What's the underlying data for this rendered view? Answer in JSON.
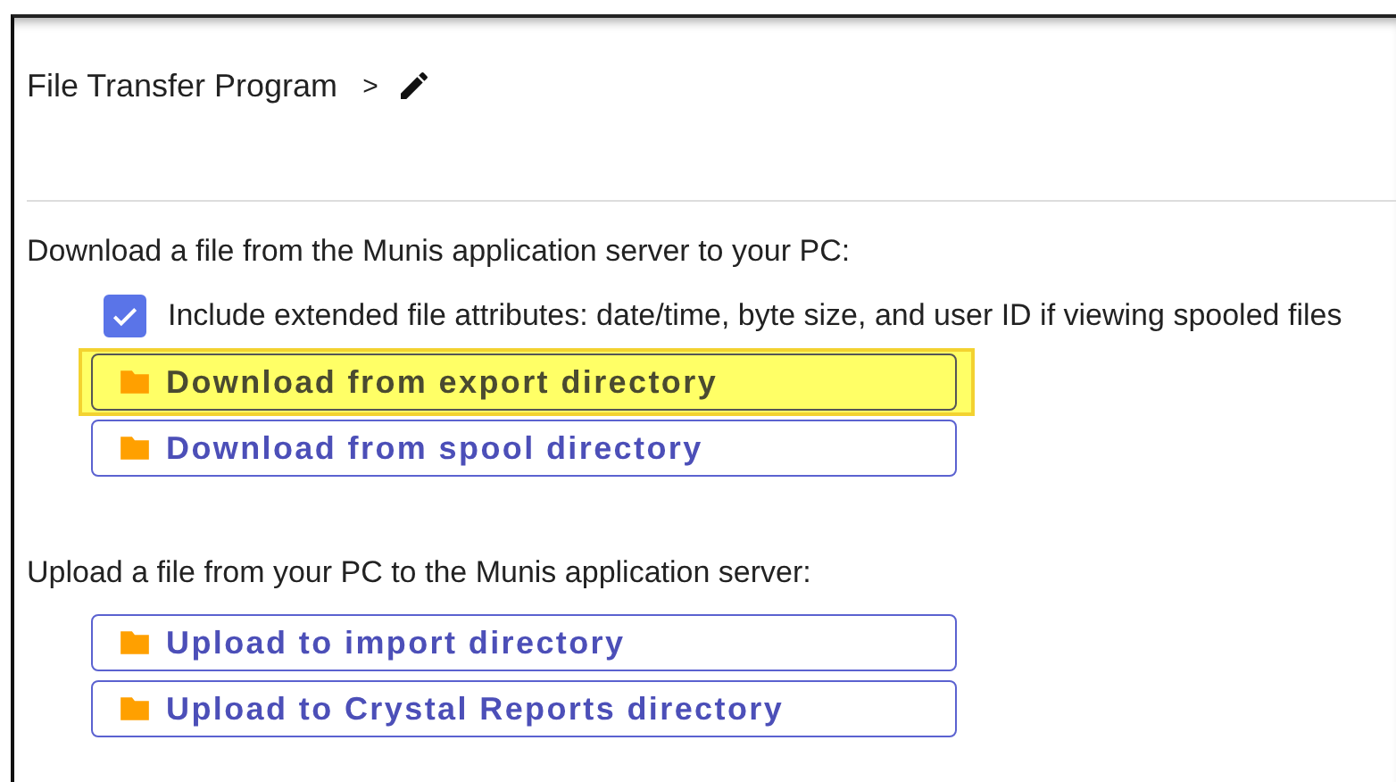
{
  "header": {
    "title": "File Transfer Program",
    "separator": ">"
  },
  "sections": [
    {
      "label": "Download a file from the Munis application server to your PC:",
      "checkbox": {
        "label": "Include extended file attributes: date/time, byte size, and user ID if viewing spooled files",
        "checked": true
      },
      "buttons": [
        {
          "label": "Download from export directory",
          "selected": true
        },
        {
          "label": "Download from spool directory",
          "selected": false
        }
      ]
    },
    {
      "label": "Upload a file from your PC to the Munis application server:",
      "buttons": [
        {
          "label": "Upload to import directory",
          "selected": false
        },
        {
          "label": "Upload to Crystal Reports directory",
          "selected": false
        }
      ]
    }
  ]
}
